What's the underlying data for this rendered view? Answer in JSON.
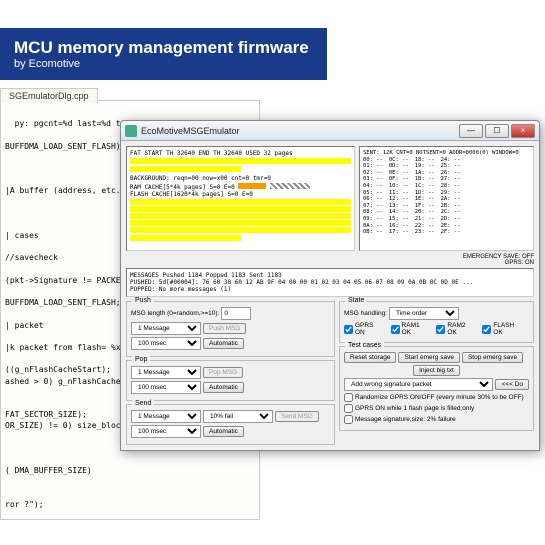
{
  "banner": {
    "title": "MCU memory management firmware",
    "subtitle": "by Ecomotive"
  },
  "code_tab": "SGEmulatorDlg.cpp",
  "code": "py: pgcnt=%d last=%d total=%d\\n\", temp,g_nRamSentlastCnt,temp + g_nRamSentlastCnt);\n\nBUFFDMA_LOAD_SENT_FLASH);\n\n\n\n|A buffer (address, etc.)\n\n\n\n| cases\n\n//savecheck\n\n(pkt->Signature != PACKET_SIG\n\nBUFFDMA_LOAD_SENT_FLASH;\n\n| packet\n\n|k packet from flash= %x\\n\",|\n\n((g_nFlashCacheStart);\nashed > 0) g_nFlashCacheUsed --;\n\n\nFAT_SECTOR_SIZE);\nOR_SIZE) != 0) size_blocks++;\n\n\n\n( DMA_BUFFER_SIZE)\n\n\nror ?\");",
  "emu": {
    "title": "EcoMotiveMSGEmulator",
    "fat_header1": "FAT  START  TH 32640       END  TH 32640         USED 32 pages",
    "fat_header2": "BACKGROUND: reqn=00 now=x00 cnt=0 tmr=0",
    "fat_header3": "RAM CACHE[5*4k pages] S=0 E=0",
    "fat_header4": "FLASH CACHE[1620*4k pages] S=0 E=0",
    "sent_header": "SENT: 12K CNT=0 NOTSENT=0 ADDR=0000(0)  WINDOW=0",
    "emergency": "EMERGENCY SAVE: OFF",
    "gprs": "GPRS: ON",
    "msg1": "MESSAGES Pushed 1184 Popped 1183 Sent 1183",
    "msg2": "PUSHED: 5d[#00004]: 76 60 38 60 12 AB 9F 04 00 00 01 02 03 04 05 06 07 08 09 0A 0B 0C 0D 0E ...",
    "msg3": "POPPED: No more messages (1)",
    "push": {
      "label": "Push",
      "len_label": "MSG length (0=random,>=10):",
      "len_val": "0",
      "sel": "1 Message",
      "btn": "Push MSG",
      "auto": "Automatic"
    },
    "pop": {
      "label": "Pop",
      "sel": "1 Message",
      "btn": "Pop MSG",
      "auto": "Automatic"
    },
    "send": {
      "label": "Send",
      "sel1": "1 Message",
      "sel2": "10% fail",
      "btn": "Send MSG",
      "auto": "Automatic"
    },
    "state": {
      "label": "State",
      "handling_label": "MSG handling:",
      "handling_sel": "Time order",
      "gprs_on": "GPRS ON",
      "ram1": "RAM1 OK",
      "ram2": "RAM2 OK",
      "flash": "FLASH OK"
    },
    "test": {
      "label": "Test cases",
      "reset": "Reset storage",
      "start": "Start emerg save",
      "stop": "Stop emerg save",
      "inject": "Inject big txt",
      "sig_sel": "Add wrong signature packet",
      "do": "<<< Do",
      "rand": "Randomize GPRS ON/OFF (every minute 30% to be OFF)",
      "gprs1": "GPRS ON while 1 flash page is filled;only",
      "sig2": "Message signature;size: 2% failure"
    }
  }
}
